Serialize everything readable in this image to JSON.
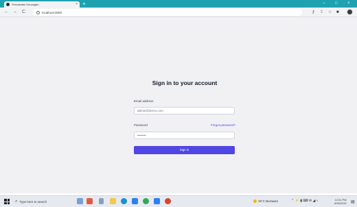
{
  "browser": {
    "tab_title": "Pencatatan Keuangan",
    "tab_close": "×",
    "new_tab": "+",
    "url": "localhost:3000",
    "back": "←",
    "forward": "→",
    "reload": "C",
    "minimize": "–",
    "maximize": "□",
    "close": "×"
  },
  "page": {
    "title": "Sign in to your account",
    "email_label": "Email address",
    "email_value": "admin@demo.com",
    "password_label": "Password",
    "password_value": "••••••••",
    "forgot_label": "Forgot password?",
    "signin_label": "Sign in"
  },
  "taskbar": {
    "search_placeholder": "Type here to search",
    "weather": "29°C Berawan",
    "time": "12:31 PM",
    "date": "6/30/2021"
  },
  "colors": {
    "tab_strip": "#1fa2b0",
    "page_bg": "#f1f1f4",
    "primary": "#5046e4"
  }
}
